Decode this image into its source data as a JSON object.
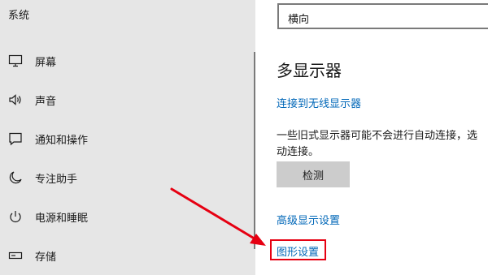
{
  "sidebar": {
    "title": "系统",
    "items": [
      {
        "label": "屏幕",
        "icon": "monitor-icon"
      },
      {
        "label": "声音",
        "icon": "speaker-icon"
      },
      {
        "label": "通知和操作",
        "icon": "notification-icon"
      },
      {
        "label": "专注助手",
        "icon": "moon-icon"
      },
      {
        "label": "电源和睡眠",
        "icon": "power-icon"
      },
      {
        "label": "存储",
        "icon": "storage-icon"
      }
    ]
  },
  "main": {
    "orientation": {
      "value": "横向"
    },
    "multi_display_title": "多显示器",
    "connect_wireless_link": "连接到无线显示器",
    "description_line1": "一些旧式显示器可能不会进行自动连接，选",
    "description_line2": "动连接。",
    "detect_button": "检测",
    "advanced_display_link": "高级显示设置",
    "graphics_settings_link": "图形设置"
  },
  "annotation": {
    "color": "#e60012"
  },
  "colors": {
    "link": "#0067b8",
    "sidebar_bg": "#e6e6e6",
    "button_bg": "#cccccc"
  }
}
